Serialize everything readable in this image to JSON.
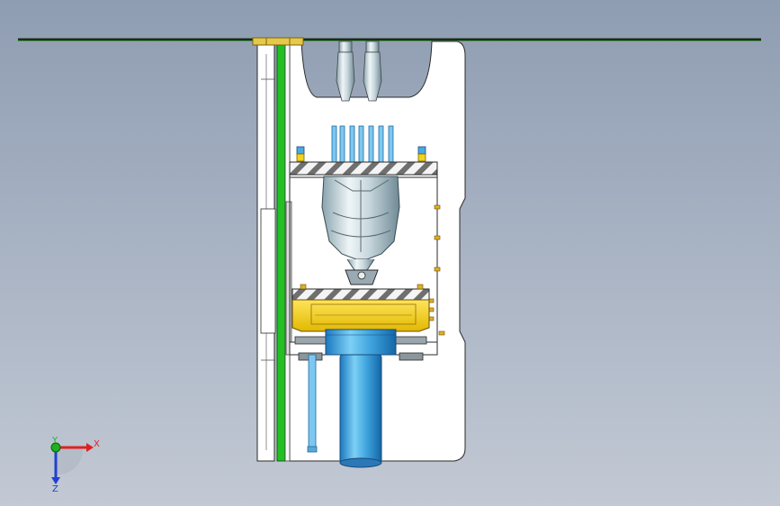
{
  "viewport": {
    "background_top": "#8f9db2",
    "background_bottom": "#c2c9d4"
  },
  "colors": {
    "frame": "#ffffff",
    "outline": "#2a2a2a",
    "green_rail": "#22c022",
    "yellow": "#f2d21c",
    "blue_cylinder": "#4aa9e0",
    "chrome": "#c8d7de"
  },
  "triad": {
    "x_label": "X",
    "y_label": "Y",
    "z_label": "Z",
    "x_color": "#e02020",
    "y_color": "#20b020",
    "z_color": "#2040d0"
  }
}
